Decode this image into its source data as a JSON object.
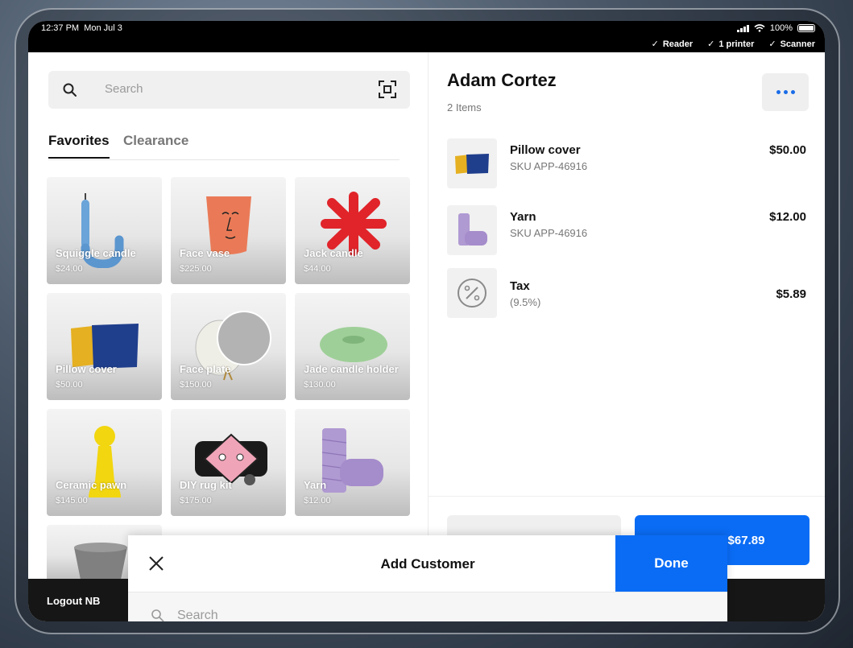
{
  "status_bar": {
    "time": "12:37 PM",
    "date": "Mon Jul 3",
    "battery": "100%",
    "devices": [
      "Reader",
      "1 printer",
      "Scanner"
    ]
  },
  "catalog": {
    "search_placeholder": "Search",
    "tabs": [
      {
        "label": "Favorites",
        "active": true
      },
      {
        "label": "Clearance",
        "active": false
      }
    ],
    "items": [
      {
        "name": "Squiggle candle",
        "price": "$24.00"
      },
      {
        "name": "Face vase",
        "price": "$225.00"
      },
      {
        "name": "Jack candle",
        "price": "$44.00"
      },
      {
        "name": "Pillow cover",
        "price": "$50.00"
      },
      {
        "name": "Face plate",
        "price": "$150.00"
      },
      {
        "name": "Jade candle holder",
        "price": "$130.00"
      },
      {
        "name": "Ceramic pawn",
        "price": "$145.00"
      },
      {
        "name": "DIY rug kit",
        "price": "$175.00"
      },
      {
        "name": "Yarn",
        "price": "$12.00"
      }
    ]
  },
  "cart": {
    "customer_name": "Adam Cortez",
    "item_count": "2 Items",
    "lines": [
      {
        "name": "Pillow cover",
        "sub": "SKU APP-46916",
        "price": "$50.00"
      },
      {
        "name": "Yarn",
        "sub": "SKU APP-46916",
        "price": "$12.00"
      },
      {
        "name": "Tax",
        "sub": "(9.5%)",
        "price": "$5.89"
      }
    ],
    "charge_label": "$67.89"
  },
  "bottom_bar": {
    "logout_label": "Logout NB"
  },
  "add_customer_sheet": {
    "title": "Add Customer",
    "done_label": "Done",
    "search_placeholder": "Search"
  },
  "colors": {
    "accent": "#0a6cf5"
  }
}
